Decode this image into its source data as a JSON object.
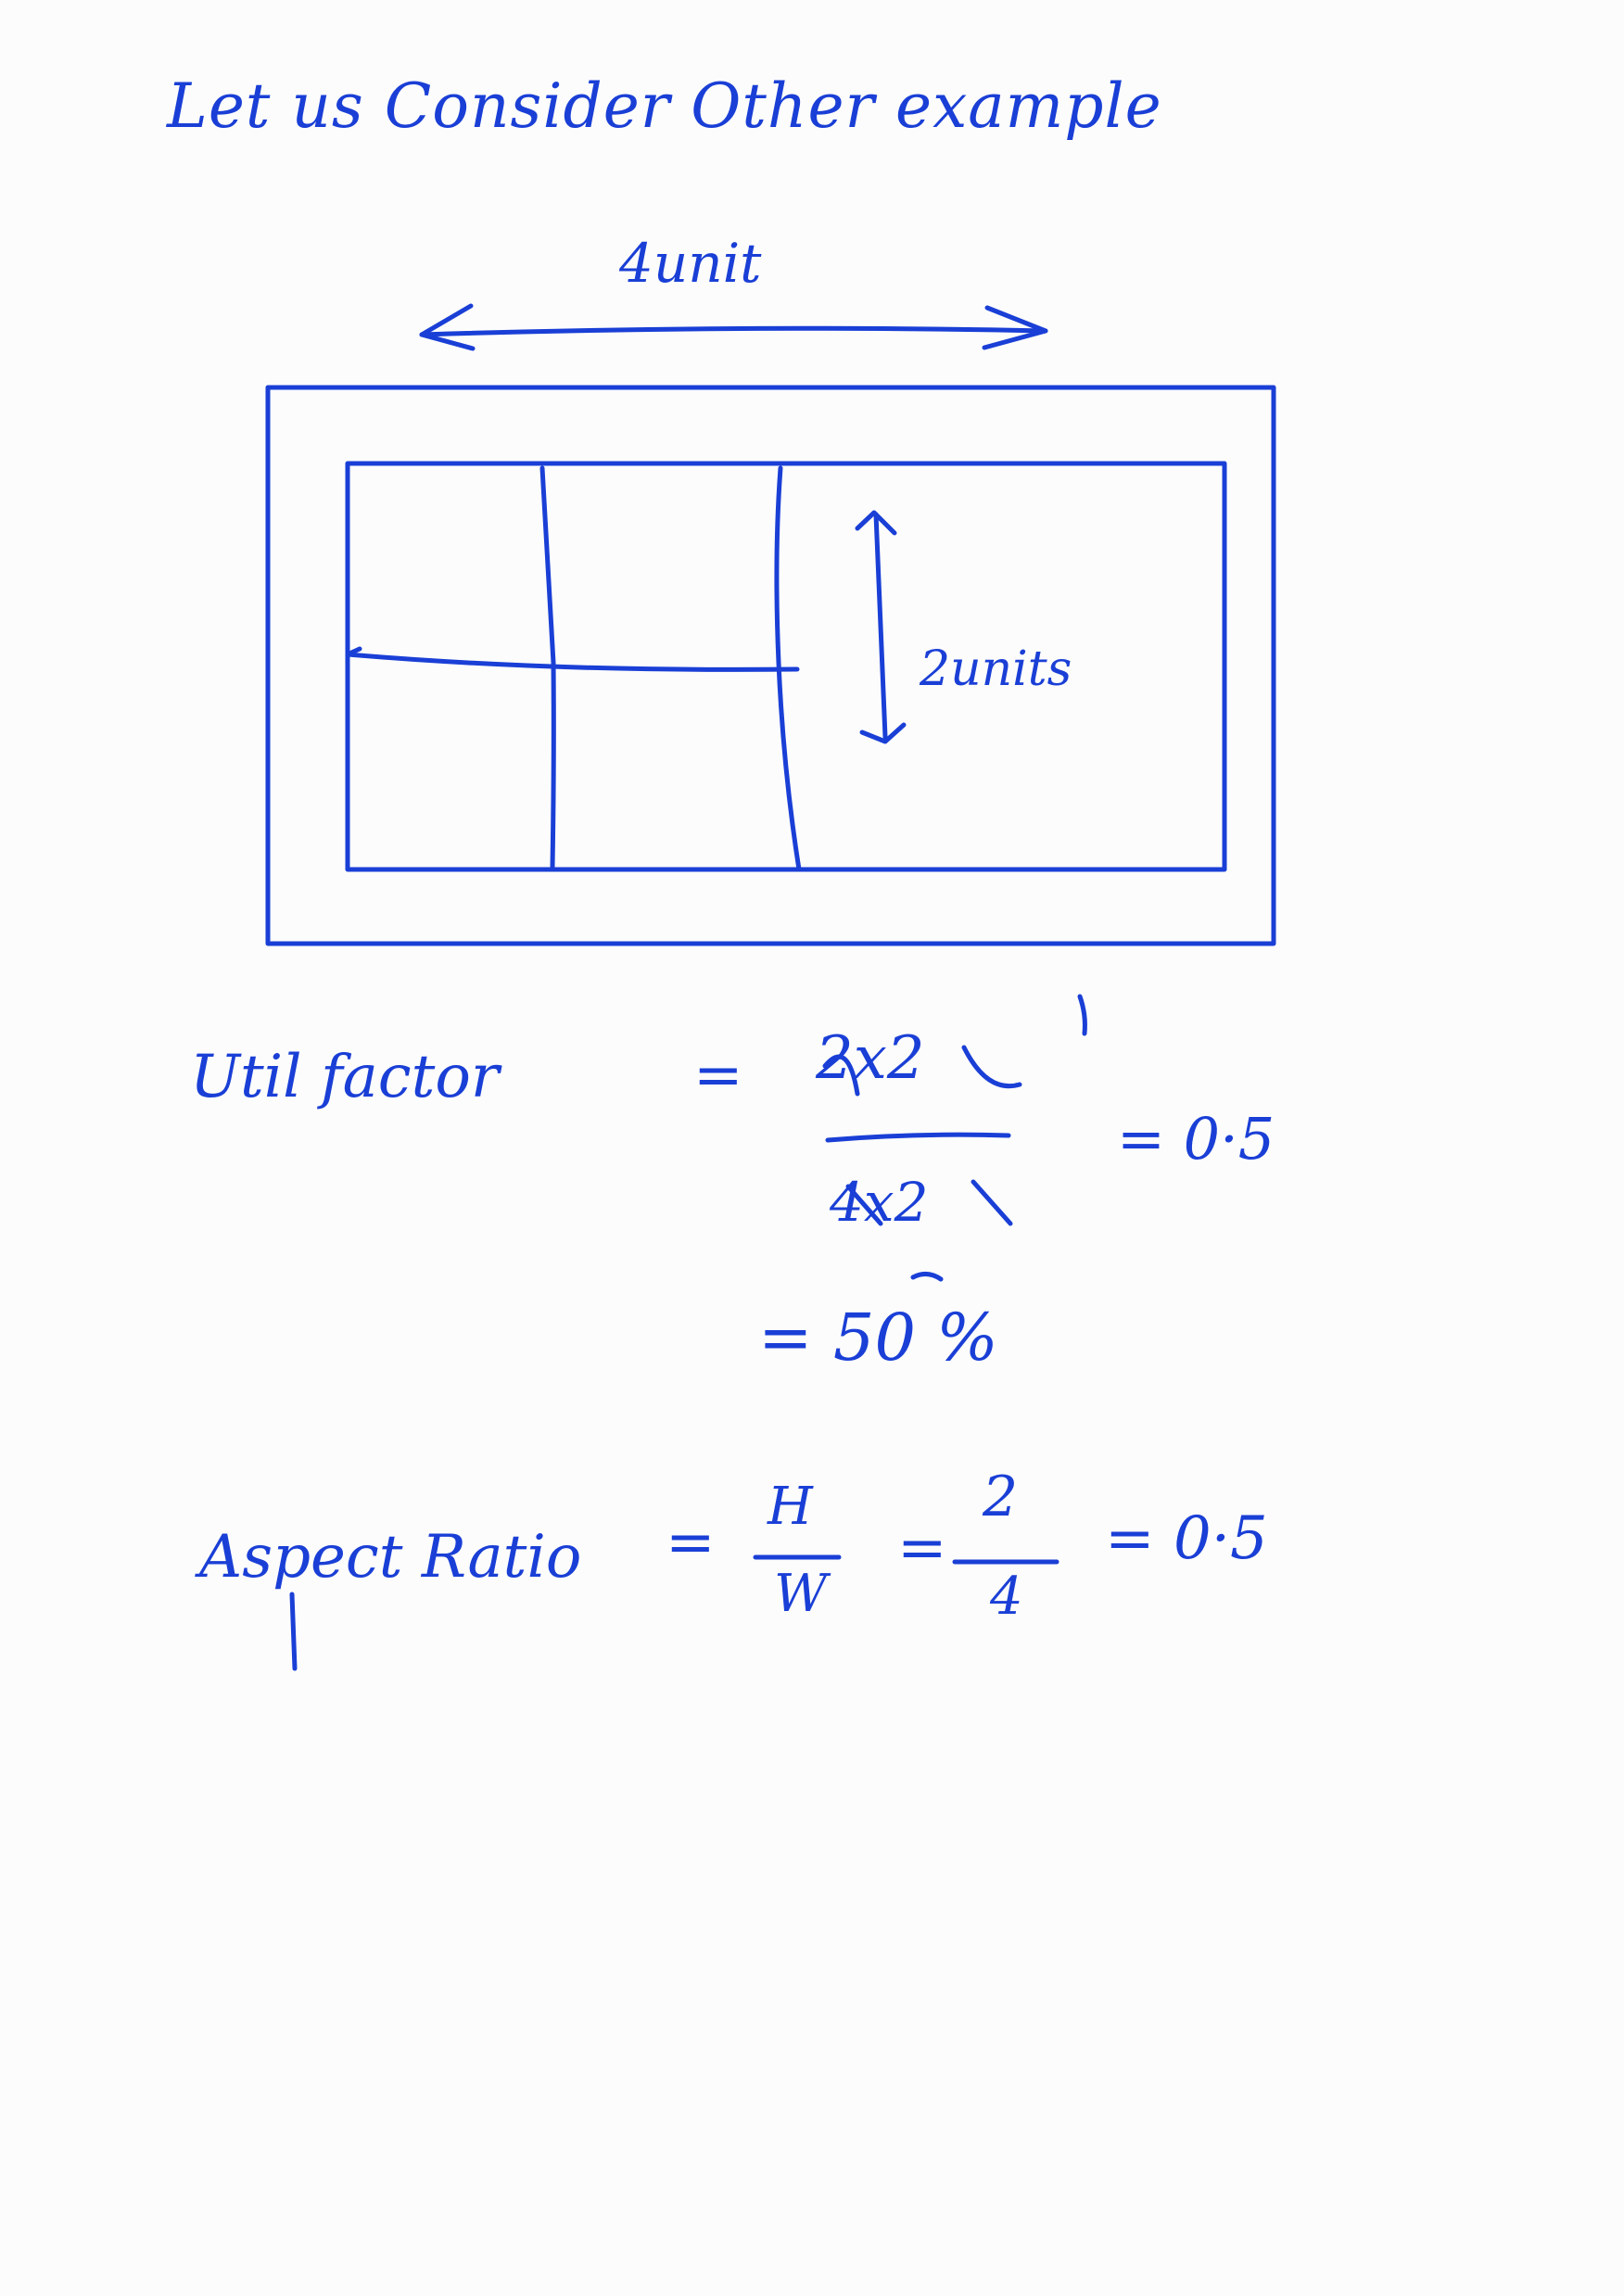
{
  "heading": "Let us Consider Other example",
  "diagram": {
    "width_label": "4unit",
    "height_label": "2units"
  },
  "util_factor": {
    "label": "Util factor",
    "equals": "=",
    "numerator": "2x2",
    "denominator": "4x2",
    "result": "= 0·5",
    "percent": "= 50 %"
  },
  "aspect_ratio": {
    "label": "Aspect Ratio",
    "equals": "=",
    "h": "H",
    "w": "W",
    "num": "2",
    "den": "4",
    "result": "= 0·5"
  },
  "colors": {
    "ink": "#1a3fd6",
    "paper": "#fcfcfc"
  }
}
